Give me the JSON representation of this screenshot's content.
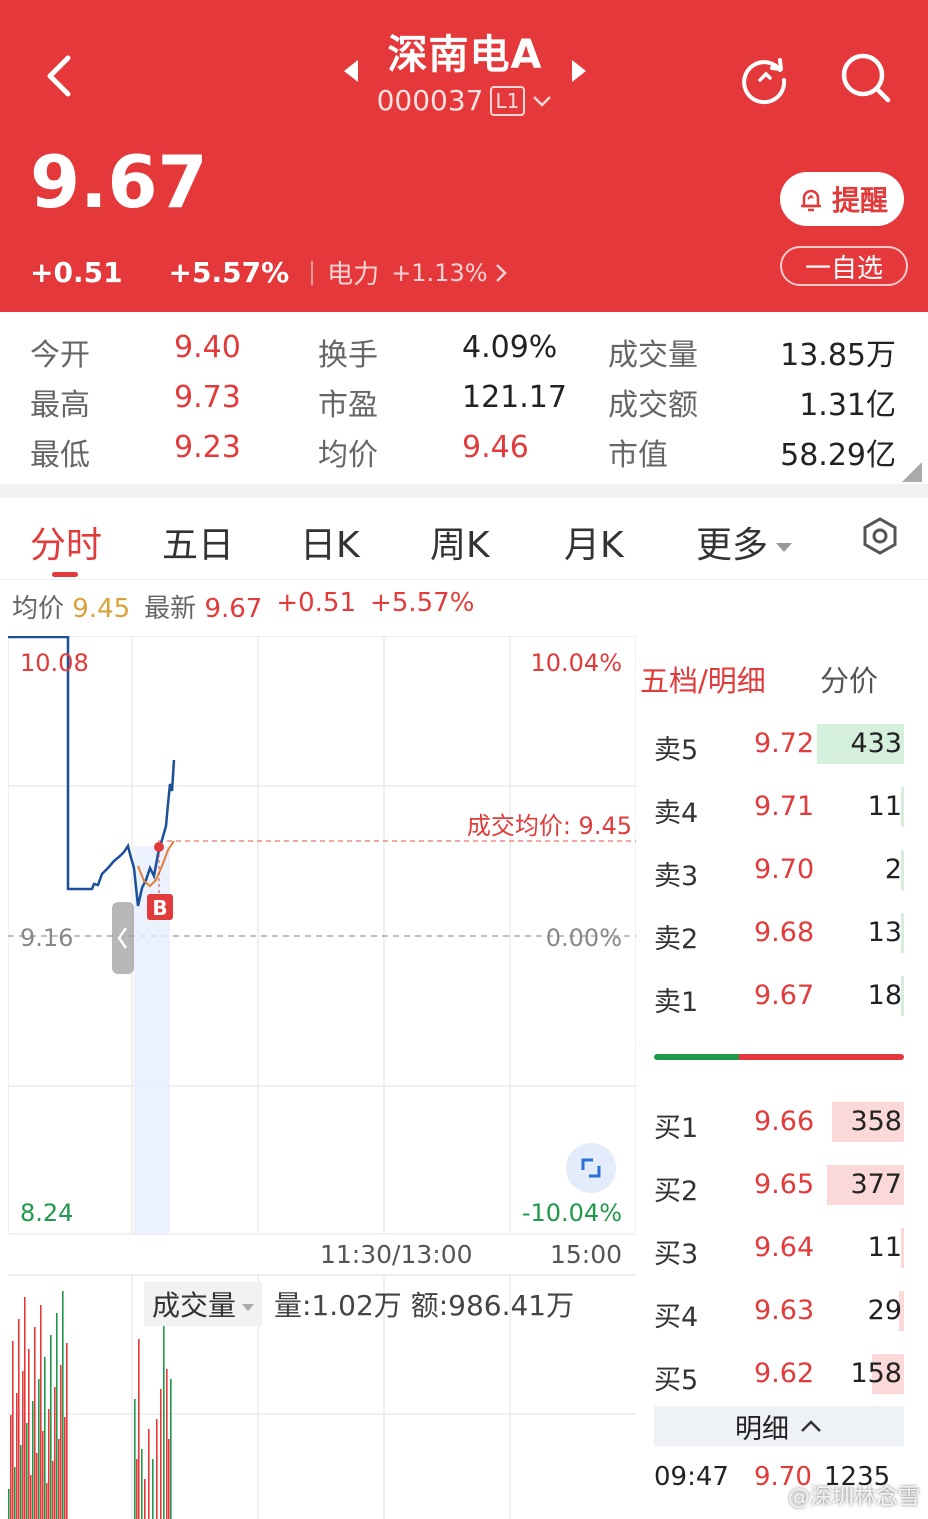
{
  "header": {
    "stock_name": "深南电A",
    "stock_code": "000037",
    "level": "L1",
    "price": "9.67",
    "change": "+0.51",
    "change_pct": "+5.57%",
    "sector": "电力",
    "sector_change": "+1.13%",
    "remind_label": "提醒",
    "watchlist_label": "一自选",
    "bg_color": "#e5383b"
  },
  "stats": {
    "open_label": "今开",
    "open": "9.40",
    "high_label": "最高",
    "high": "9.73",
    "low_label": "最低",
    "low": "9.23",
    "turnover_label": "换手",
    "turnover": "4.09%",
    "pe_label": "市盈",
    "pe": "121.17",
    "avg_label": "均价",
    "avg": "9.46",
    "volume_label": "成交量",
    "volume": "13.85万",
    "amount_label": "成交额",
    "amount": "1.31亿",
    "mcap_label": "市值",
    "mcap": "58.29亿"
  },
  "tabs": [
    "分时",
    "五日",
    "日K",
    "周K",
    "月K",
    "更多"
  ],
  "info": {
    "avg_label": "均价",
    "avg": "9.45",
    "latest_label": "最新",
    "latest": "9.67",
    "change": "+0.51",
    "change_pct": "+5.57%"
  },
  "chart_data": {
    "type": "line",
    "y_top": "10.08",
    "y_mid": "9.16",
    "y_bottom": "8.24",
    "pct_top": "10.04%",
    "pct_mid": "0.00%",
    "pct_bottom": "-10.04%",
    "avg_line_label": "成交均价: 9.45",
    "marker_label": "B",
    "time_mid": "11:30/13:00",
    "time_end": "15:00"
  },
  "volume_panel": {
    "label": "成交量",
    "vol_info": "量:1.02万 额:986.41万"
  },
  "orderbook": {
    "title": "五档/明细",
    "tick_label": "分价",
    "asks": [
      {
        "label": "卖5",
        "price": "9.72",
        "vol": "433",
        "frac": 0.35
      },
      {
        "label": "卖4",
        "price": "9.71",
        "vol": "11",
        "frac": 0.01
      },
      {
        "label": "卖3",
        "price": "9.70",
        "vol": "2",
        "frac": 0.01
      },
      {
        "label": "卖2",
        "price": "9.68",
        "vol": "13",
        "frac": 0.01
      },
      {
        "label": "卖1",
        "price": "9.67",
        "vol": "18",
        "frac": 0.01
      }
    ],
    "bids": [
      {
        "label": "买1",
        "price": "9.66",
        "vol": "358",
        "frac": 0.29
      },
      {
        "label": "买2",
        "price": "9.65",
        "vol": "377",
        "frac": 0.31
      },
      {
        "label": "买3",
        "price": "9.64",
        "vol": "11",
        "frac": 0.01
      },
      {
        "label": "买4",
        "price": "9.63",
        "vol": "29",
        "frac": 0.02
      },
      {
        "label": "买5",
        "price": "9.62",
        "vol": "158",
        "frac": 0.13
      }
    ],
    "detail_label": "明细",
    "detail_time": "09:47",
    "detail_price": "9.70",
    "detail_vol": "1235"
  },
  "watermark": "@深圳林念雪"
}
